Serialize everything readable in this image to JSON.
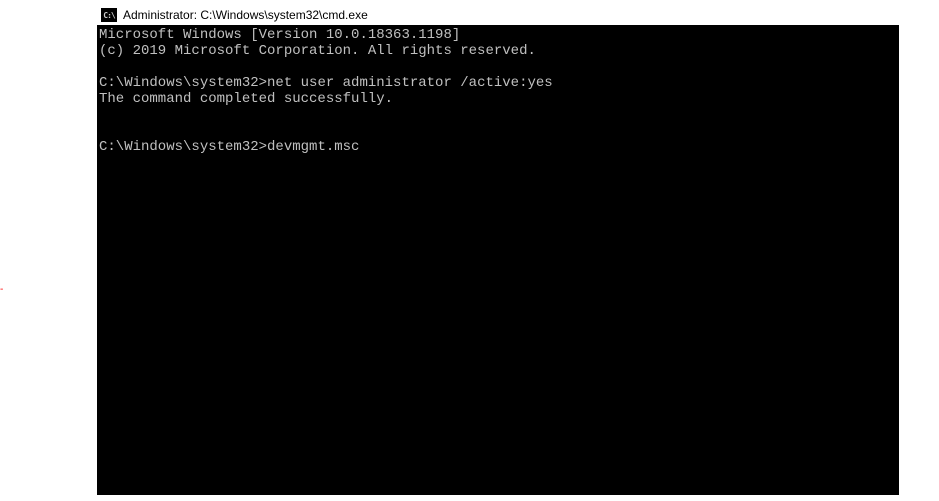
{
  "titlebar": {
    "icon_label": "C:\\",
    "title": "Administrator: C:\\Windows\\system32\\cmd.exe"
  },
  "console": {
    "line1": "Microsoft Windows [Version 10.0.18363.1198]",
    "line2": "(c) 2019 Microsoft Corporation. All rights reserved.",
    "blank1": "",
    "prompt1": "C:\\Windows\\system32>",
    "cmd1": "net user administrator /active:yes",
    "result1": "The command completed successfully.",
    "blank2": "",
    "blank3": "",
    "prompt2": "C:\\Windows\\system32>",
    "cmd2": "devmgmt.msc"
  },
  "decoration": {
    "dash": "-"
  }
}
